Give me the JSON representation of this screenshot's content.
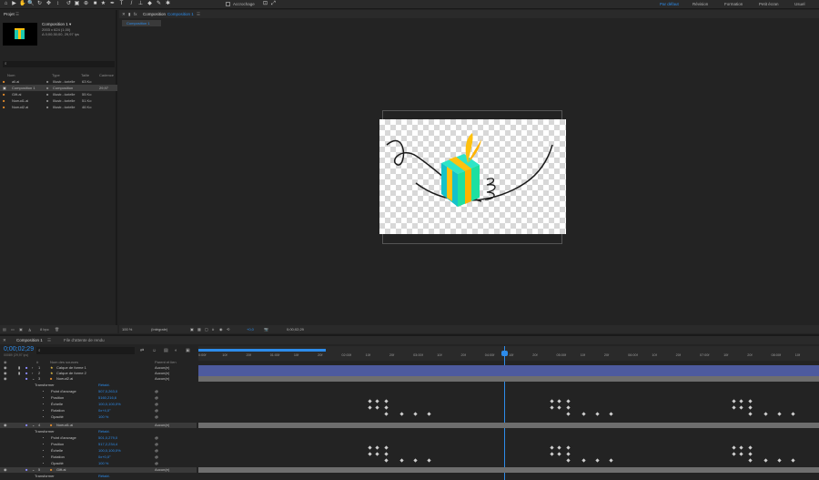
{
  "toolbar": {
    "snap_label": "Accrochage",
    "workspaces": [
      "Par défaut",
      "Révision",
      "Formation",
      "Petit écran",
      "Usuel"
    ],
    "active_workspace": "Par défaut"
  },
  "project": {
    "tab": "Projet",
    "comp_name": "Composition 1 ▾",
    "comp_info1": "2003 x 624 (1,00)",
    "comp_info2": "Δ 0;00;30;00, 29,97 ips",
    "search_placeholder": "",
    "headers": {
      "name": "Nom",
      "type": "Type",
      "size": "Taille",
      "rate": "Cadence"
    },
    "files": [
      {
        "name": "all.ai",
        "type": "Illustr...torielle",
        "size": "63 Ko",
        "rate": ""
      },
      {
        "name": "Composition 1",
        "type": "Composition",
        "size": "",
        "rate": "29,97"
      },
      {
        "name": "Gift.ai",
        "type": "Illustr...torielle",
        "size": "55 Ko",
        "rate": ""
      },
      {
        "name": "Noeud1.ai",
        "type": "Illustr...torielle",
        "size": "51 Ko",
        "rate": ""
      },
      {
        "name": "Noeud2.ai",
        "type": "Illustr...torielle",
        "size": "46 Ko",
        "rate": ""
      }
    ],
    "bpc": "8 bpc"
  },
  "viewer": {
    "tab_prefix": "Composition",
    "tab_comp": "Composition 1",
    "subtab": "Composition 1",
    "zoom": "100 %",
    "resolution": "(Intégrale)",
    "exposure": "+0,0",
    "timecode": "0;00;02;29"
  },
  "timeline": {
    "tab": "Composition 1",
    "render_queue": "File d'attente de rendu",
    "current_time": "0;00;02;29",
    "frame_info": "00089 (29,97 ips)",
    "col_name": "Nom des sources",
    "col_parent": "Parent et lien",
    "ruler": [
      "0:00f",
      "10f",
      "20f",
      "01:00f",
      "10f",
      "20f",
      "02:00f",
      "10f",
      "20f",
      "03:00f",
      "10f",
      "20f",
      "04:00f",
      "10f",
      "20f",
      "05:00f",
      "10f",
      "20f",
      "06:00f",
      "10f",
      "20f",
      "07:00f",
      "10f",
      "20f",
      "08:00f",
      "10f"
    ],
    "layers": [
      {
        "num": "1",
        "name": "Calque de forme 1",
        "parent": "Aucun(e)"
      },
      {
        "num": "2",
        "name": "Calque de forme 2",
        "parent": "Aucun(e)"
      },
      {
        "num": "3",
        "name": "Noeud2.ai",
        "parent": "Aucun(e)"
      }
    ],
    "transform_label": "Transformer",
    "reset_label": "Rétabl.",
    "props1": [
      {
        "name": "Point d'ancrage",
        "value": "507,0,263,0"
      },
      {
        "name": "Position",
        "value": "5160,216,6"
      },
      {
        "name": "Échelle",
        "value": "100,0,100,0%"
      },
      {
        "name": "Rotation",
        "value": "0x+4,0°"
      },
      {
        "name": "Opacité",
        "value": "100 %"
      }
    ],
    "layer4": {
      "num": "4",
      "name": "Noeud1.ai",
      "parent": "Aucun(e)"
    },
    "props2": [
      {
        "name": "Point d'ancrage",
        "value": "501,0,279,0"
      },
      {
        "name": "Position",
        "value": "517,2,234,4"
      },
      {
        "name": "Échelle",
        "value": "100,0,100,0%"
      },
      {
        "name": "Rotation",
        "value": "0x+0,0°"
      },
      {
        "name": "Opacité",
        "value": "100 %"
      }
    ],
    "layer5": {
      "num": "5",
      "name": "Gift.ai",
      "parent": "Aucun(e)"
    },
    "transform_label2": "Transformer",
    "reset_label2": "Rétabl."
  },
  "colors": {
    "accent": "#2d8ceb",
    "bg": "#232323"
  }
}
